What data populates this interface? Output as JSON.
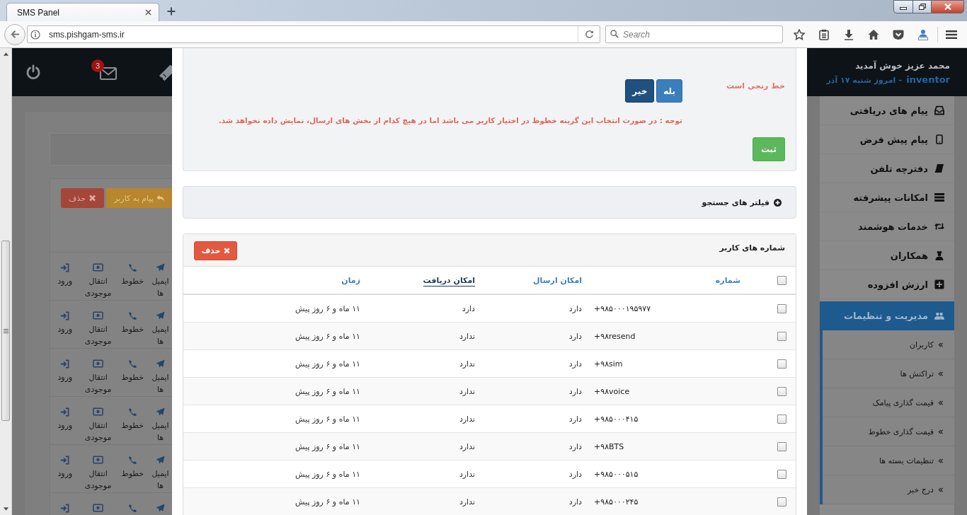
{
  "browser": {
    "tab_title": "SMS Panel",
    "url": "sms.pishgam-sms.ir",
    "search_placeholder": "Search"
  },
  "header": {
    "notification_count": "3",
    "welcome": "محمد عزیز خوش آمدید",
    "user": "inventor",
    "date": "– امروز شنبه ۱۷ آذر"
  },
  "background_panel": {
    "buttons": [
      {
        "kind": "reply",
        "label": "پیام به کاربر"
      },
      {
        "kind": "delete",
        "label": "حذف"
      }
    ],
    "rows": [
      {
        "actions": [
          {
            "kind": "email",
            "label": "ایمیل ها"
          },
          {
            "kind": "lines",
            "label": "خطوط"
          },
          {
            "kind": "transfer",
            "label": "انتقال موجودی"
          },
          {
            "kind": "login",
            "label": "ورود"
          }
        ]
      },
      {
        "actions": [
          {
            "kind": "email",
            "label": "ایمیل ها"
          },
          {
            "kind": "lines",
            "label": "خطوط"
          },
          {
            "kind": "transfer",
            "label": "انتقال موجودی"
          },
          {
            "kind": "login",
            "label": "ورود"
          }
        ]
      },
      {
        "actions": [
          {
            "kind": "email",
            "label": "ایمیل ها"
          },
          {
            "kind": "lines",
            "label": "خطوط"
          },
          {
            "kind": "transfer",
            "label": "انتقال موجودی"
          },
          {
            "kind": "login",
            "label": "ورود"
          }
        ]
      },
      {
        "actions": [
          {
            "kind": "email",
            "label": "ایمیل ها"
          },
          {
            "kind": "lines",
            "label": "خطوط"
          },
          {
            "kind": "transfer",
            "label": "انتقال موجودی"
          },
          {
            "kind": "login",
            "label": "ورود"
          }
        ]
      },
      {
        "actions": [
          {
            "kind": "email",
            "label": "ایمیل ها"
          },
          {
            "kind": "lines",
            "label": "خطوط"
          },
          {
            "kind": "transfer",
            "label": "انتقال موجودی"
          },
          {
            "kind": "login",
            "label": "ورود"
          }
        ]
      },
      {
        "actions": [
          {
            "kind": "email"
          },
          {
            "kind": "lines"
          },
          {
            "kind": "transfer"
          },
          {
            "kind": "login"
          }
        ]
      }
    ]
  },
  "sidebar": {
    "items": [
      {
        "label": "پیام های دریافتی",
        "expanded": false
      },
      {
        "label": "پیام پیش فرض",
        "expanded": false
      },
      {
        "label": "دفترچه تلفن",
        "expanded": false
      },
      {
        "label": "امکانات پیشرفته",
        "expanded": false
      },
      {
        "label": "خدمات هوشمند",
        "expanded": false
      },
      {
        "label": "همکاران",
        "expanded": false
      },
      {
        "label": "ارزش افزوده",
        "expanded": false
      },
      {
        "label": "مدیریت و تنظیمات",
        "expanded": true,
        "children": [
          {
            "label": "کاربران"
          },
          {
            "label": "تراکنش ها"
          },
          {
            "label": "قیمت گذاری پیامک"
          },
          {
            "label": "قیمت گذاری خطوط"
          },
          {
            "label": "تنظیمات بسته ها"
          },
          {
            "label": "درج خبر"
          }
        ]
      }
    ]
  },
  "modal": {
    "range_setting": {
      "label": "خط رنجی است",
      "options": [
        {
          "label": "بله",
          "selected": false
        },
        {
          "label": "خیر",
          "selected": true
        }
      ],
      "note": "توجه : در صورت انتخاب این گزینه خطوط در اختیار کاربر می باشد اما در هیچ کدام از بخش های ارسال، نمایش داده نخواهد شد.",
      "submit": "ثبت"
    },
    "filters": {
      "label": "فیلتر های جستجو",
      "expanded": false
    },
    "numbers": {
      "title": "شماره های کاربر",
      "delete_label": "حذف",
      "select_all_checked": false,
      "columns": [
        {
          "label": "شماره",
          "sorted": false
        },
        {
          "label": "امکان ارسال",
          "sorted": false
        },
        {
          "label": "امکان دریافت",
          "sorted": true
        },
        {
          "label": "زمان",
          "sorted": false
        }
      ],
      "rows": [
        {
          "checked": false,
          "number": "+۹۸۵۰۰۰۱۹۵۹۷۷",
          "send": "دارد",
          "receive": "دارد",
          "time": "۱۱ ماه و ۶ روز پیش"
        },
        {
          "checked": false,
          "number": "+۹۸resend",
          "send": "دارد",
          "receive": "ندارد",
          "time": "۱۱ ماه و ۶ روز پیش"
        },
        {
          "checked": false,
          "number": "+۹۸sim",
          "send": "دارد",
          "receive": "ندارد",
          "time": "۱۱ ماه و ۶ روز پیش"
        },
        {
          "checked": false,
          "number": "+۹۸voice",
          "send": "دارد",
          "receive": "ندارد",
          "time": "۱۱ ماه و ۶ روز پیش"
        },
        {
          "checked": false,
          "number": "+۹۸۵۰۰۰۴۱۵",
          "send": "دارد",
          "receive": "ندارد",
          "time": "۱۱ ماه و ۶ روز پیش"
        },
        {
          "checked": false,
          "number": "+۹۸BTS",
          "send": "دارد",
          "receive": "ندارد",
          "time": "۱۱ ماه و ۶ روز پیش"
        },
        {
          "checked": false,
          "number": "+۹۸۵۰۰۰۵۱۵",
          "send": "دارد",
          "receive": "ندارد",
          "time": "۱۱ ماه و ۶ روز پیش"
        },
        {
          "checked": false,
          "number": "+۹۸۵۰۰۰۲۴۵",
          "send": "دارد",
          "receive": "ندارد",
          "time": "۱۱ ماه و ۶ روز پیش"
        }
      ]
    }
  }
}
